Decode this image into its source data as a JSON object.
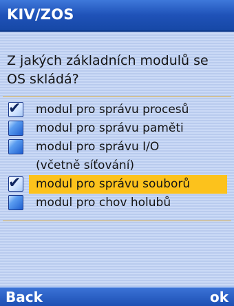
{
  "app": {
    "title": "KIV/ZOS"
  },
  "question": {
    "text": "Z jakých základních modulů se OS skládá?"
  },
  "options": [
    {
      "label": "modul pro správu procesů",
      "checked": true,
      "highlighted": false
    },
    {
      "label": "modul pro správu paměti",
      "checked": false,
      "highlighted": false
    },
    {
      "label": "modul pro správu I/O",
      "checked": false,
      "highlighted": false
    },
    {
      "label": "(včetně síťování)",
      "checked": false,
      "highlighted": false,
      "continuation": true
    },
    {
      "label": "modul pro správu souborů",
      "checked": true,
      "highlighted": true
    },
    {
      "label": "modul pro chov holubů",
      "checked": false,
      "highlighted": false
    }
  ],
  "softkeys": {
    "left": "Back",
    "right": "ok"
  },
  "icons": {
    "checkbox_checked": "checkbox-checked-icon",
    "checkbox_unchecked": "checkbox-unchecked-icon",
    "checkmark_glyph": "✔"
  },
  "colors": {
    "titlebar": "#1f52b8",
    "background": "#c9d8f4",
    "highlight": "#fcc21c",
    "divider": "#e6b64a",
    "text": "#141414"
  }
}
